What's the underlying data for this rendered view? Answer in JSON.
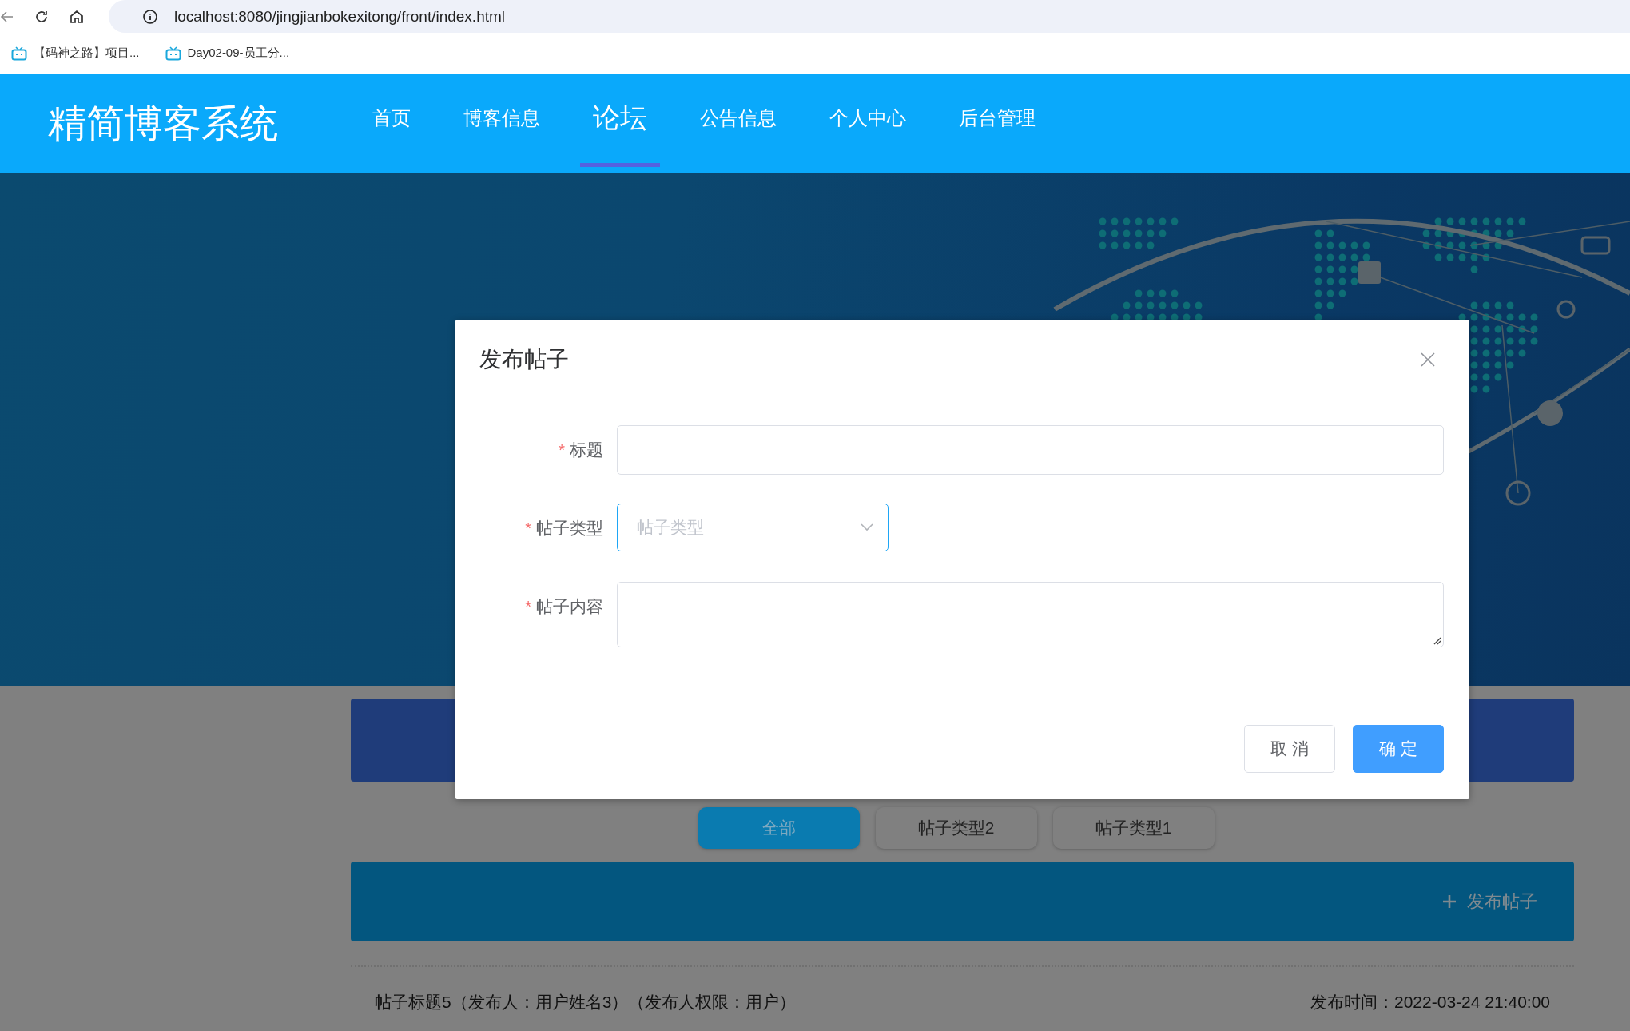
{
  "browser": {
    "url": "localhost:8080/jingjianbokexitong/front/index.html",
    "bookmarks": [
      "【码神之路】项目...",
      "Day02-09-员工分..."
    ]
  },
  "site": {
    "title": "精简博客系统"
  },
  "nav": [
    {
      "label": "首页",
      "selected": false
    },
    {
      "label": "博客信息",
      "selected": false
    },
    {
      "label": "论坛",
      "selected": true
    },
    {
      "label": "公告信息",
      "selected": false
    },
    {
      "label": "个人中心",
      "selected": false
    },
    {
      "label": "后台管理",
      "selected": false
    }
  ],
  "categories": [
    {
      "label": "全部",
      "selected": true
    },
    {
      "label": "帖子类型2",
      "selected": false
    },
    {
      "label": "帖子类型1",
      "selected": false
    }
  ],
  "publish_button": "发布帖子",
  "posts": [
    {
      "title": "帖子标题5（发布人：用户姓名3）（发布人权限：用户）",
      "time": "发布时间：2022-03-24 21:40:00"
    }
  ],
  "dialog": {
    "title": "发布帖子",
    "required_mark": "*",
    "fields": [
      {
        "kind": "text",
        "label": "标题",
        "required": true,
        "focused": false
      },
      {
        "kind": "select",
        "label": "帖子类型",
        "placeholder": "帖子类型",
        "required": true,
        "focused": true
      },
      {
        "kind": "textarea",
        "label": "帖子内容",
        "required": true,
        "focused": false
      }
    ],
    "buttons": [
      {
        "label": "取 消",
        "kind": "default"
      },
      {
        "label": "确 定",
        "kind": "primary"
      }
    ]
  }
}
